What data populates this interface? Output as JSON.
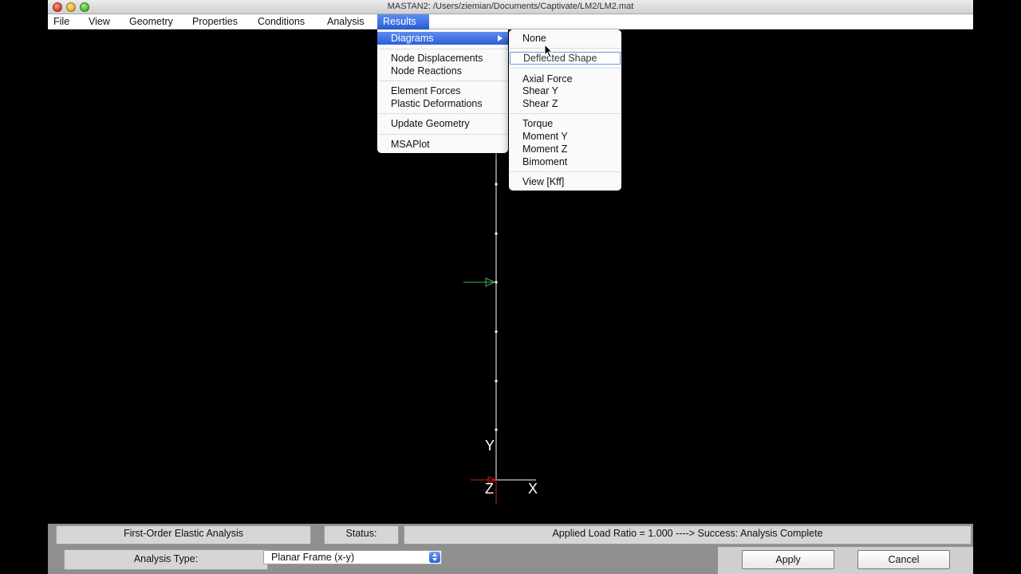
{
  "window": {
    "title": "MASTAN2:  /Users/ziemian/Documents/Captivate/LM2/LM2.mat"
  },
  "menubar": {
    "items": [
      "File",
      "View",
      "Geometry",
      "Properties",
      "Conditions",
      "Analysis",
      "Results"
    ],
    "active": "Results"
  },
  "results_menu": {
    "diagrams": "Diagrams",
    "node_displacements": "Node Displacements",
    "node_reactions": "Node Reactions",
    "element_forces": "Element Forces",
    "plastic_deformations": "Plastic Deformations",
    "update_geometry": "Update Geometry",
    "msaplot": "MSAPlot"
  },
  "diagrams_submenu": {
    "none": "None",
    "deflected_shape": "Deflected Shape",
    "axial_force": "Axial Force",
    "shear_y": "Shear Y",
    "shear_z": "Shear Z",
    "torque": "Torque",
    "moment_y": "Moment Y",
    "moment_z": "Moment Z",
    "bimoment": "Bimoment",
    "view_kff": "View [Kff]"
  },
  "axes": {
    "y": "Y",
    "x": "X",
    "z": "Z"
  },
  "status": {
    "analysis_name": "First-Order Elastic Analysis",
    "status_label": "Status:",
    "status_message": "Applied Load Ratio = 1.000  ---->  Success:  Analysis Complete",
    "analysis_type_label": "Analysis Type:",
    "analysis_type_value": "Planar Frame (x-y)",
    "apply": "Apply",
    "cancel": "Cancel"
  },
  "colors": {
    "menu_highlight": "#2d5fd8",
    "load_arrow": "#4fb060",
    "z_axis": "#cc2222"
  }
}
